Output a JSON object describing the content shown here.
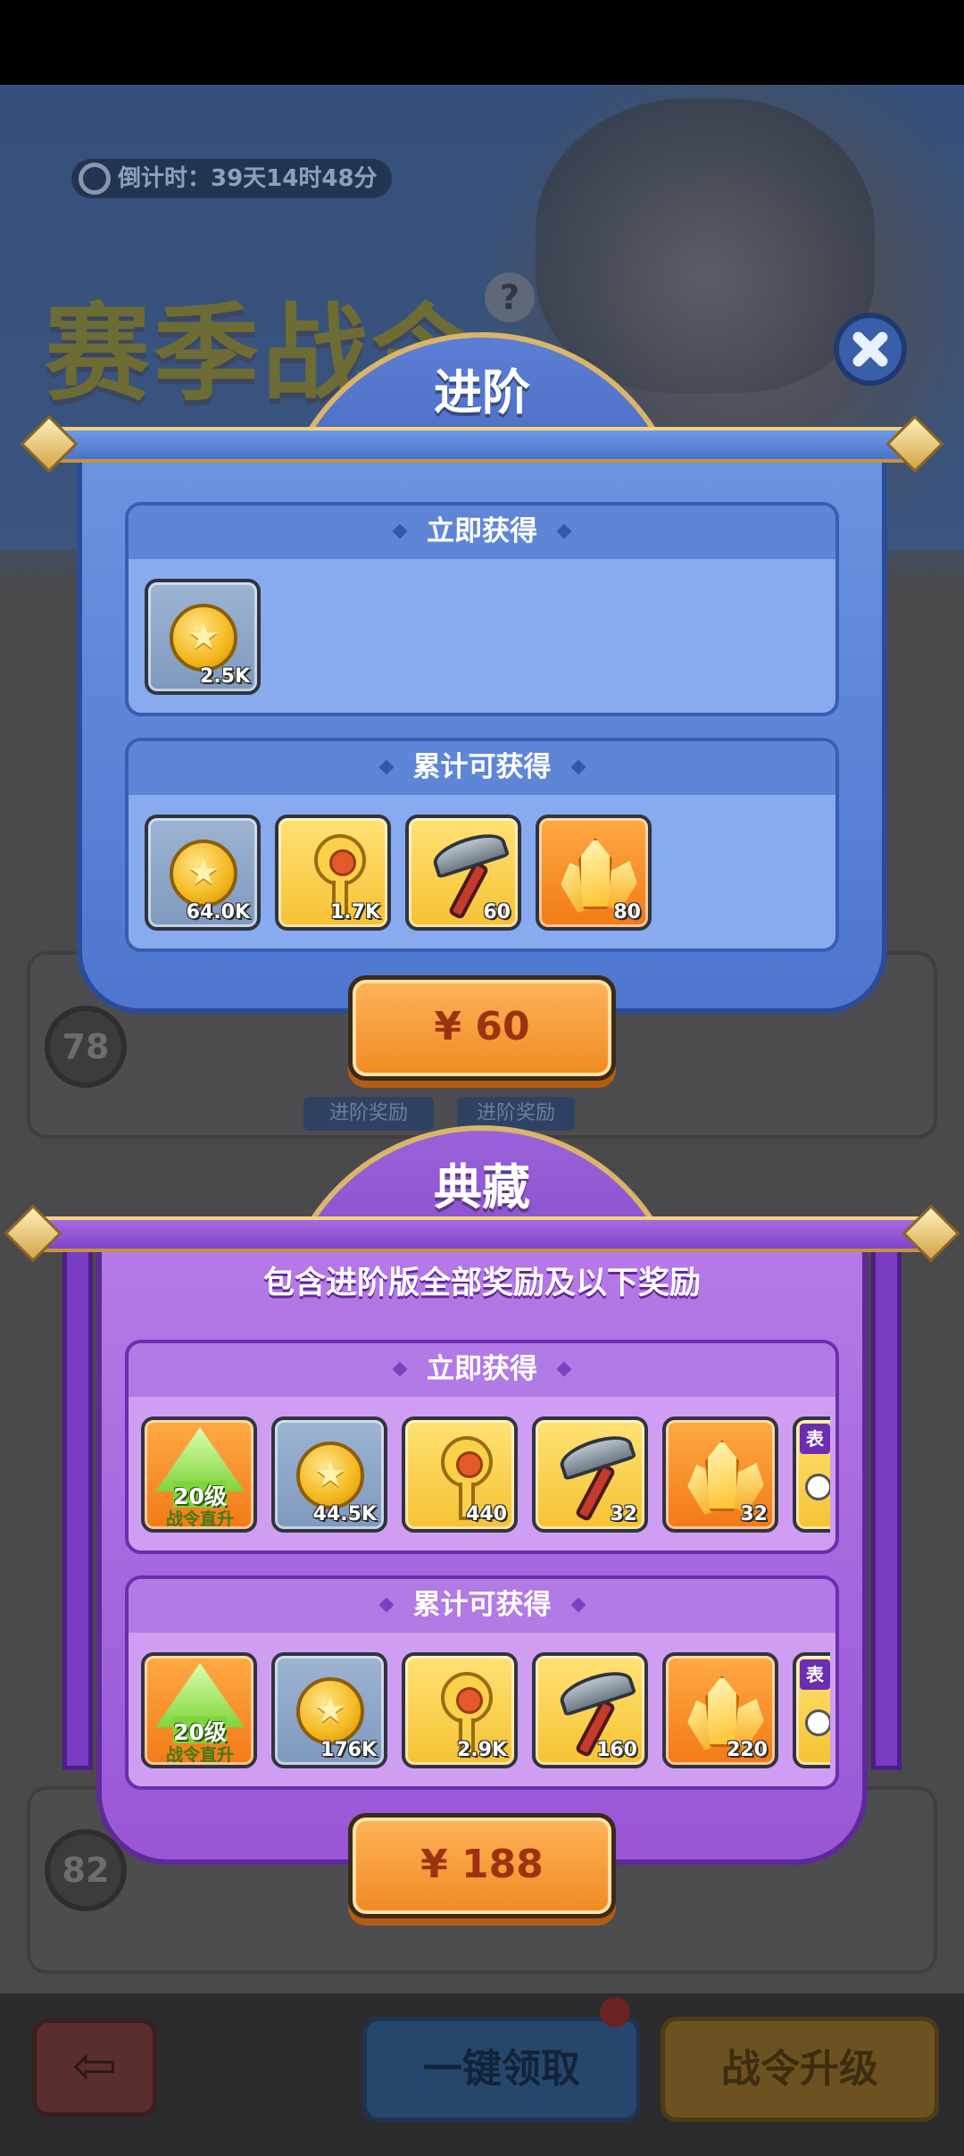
{
  "background": {
    "timer": "倒计时：39天14时48分",
    "season_title": "赛季战令",
    "help_glyph": "?",
    "levels": [
      "78",
      "82"
    ],
    "chips": [
      "进阶奖励",
      "进阶奖励"
    ],
    "bottom_buttons": {
      "claim_all": "一键领取",
      "upgrade": "战令升级"
    }
  },
  "advanced": {
    "title": "进阶",
    "immediate": {
      "heading": "立即获得",
      "items": [
        {
          "icon": "coin-icon",
          "qty": "2.5K",
          "bg": "blue"
        }
      ]
    },
    "cumulative": {
      "heading": "累计可获得",
      "items": [
        {
          "icon": "coin-icon",
          "qty": "64.0K",
          "bg": "blue"
        },
        {
          "icon": "key-icon",
          "qty": "1.7K",
          "bg": "yellow"
        },
        {
          "icon": "pickaxe-icon",
          "qty": "60",
          "bg": "yellow"
        },
        {
          "icon": "crystal-icon",
          "qty": "80",
          "bg": "orange"
        }
      ]
    },
    "price": "¥ 60"
  },
  "collector": {
    "title": "典藏",
    "subtitle": "包含进阶版全部奖励及以下奖励",
    "immediate": {
      "heading": "立即获得",
      "items": [
        {
          "icon": "level-up-arrow-icon",
          "level": "20级",
          "sub": "战令直升",
          "bg": "orange"
        },
        {
          "icon": "coin-icon",
          "qty": "44.5K",
          "bg": "blue"
        },
        {
          "icon": "key-icon",
          "qty": "440",
          "bg": "yellow"
        },
        {
          "icon": "pickaxe-icon",
          "qty": "32",
          "bg": "yellow"
        },
        {
          "icon": "crystal-icon",
          "qty": "32",
          "bg": "orange"
        },
        {
          "icon": "emote-icon",
          "tag": "表",
          "bg": "yellow"
        }
      ]
    },
    "cumulative": {
      "heading": "累计可获得",
      "items": [
        {
          "icon": "level-up-arrow-icon",
          "level": "20级",
          "sub": "战令直升",
          "bg": "orange"
        },
        {
          "icon": "coin-icon",
          "qty": "176K",
          "bg": "blue"
        },
        {
          "icon": "key-icon",
          "qty": "2.9K",
          "bg": "yellow"
        },
        {
          "icon": "pickaxe-icon",
          "qty": "160",
          "bg": "yellow"
        },
        {
          "icon": "crystal-icon",
          "qty": "220",
          "bg": "orange"
        },
        {
          "icon": "emote-icon",
          "tag": "表",
          "bg": "yellow"
        }
      ]
    },
    "price": "¥ 188"
  },
  "colors": {
    "advanced_accent": "#5f86d6",
    "collector_accent": "#b27ae4",
    "price_button": "#f08a22"
  }
}
